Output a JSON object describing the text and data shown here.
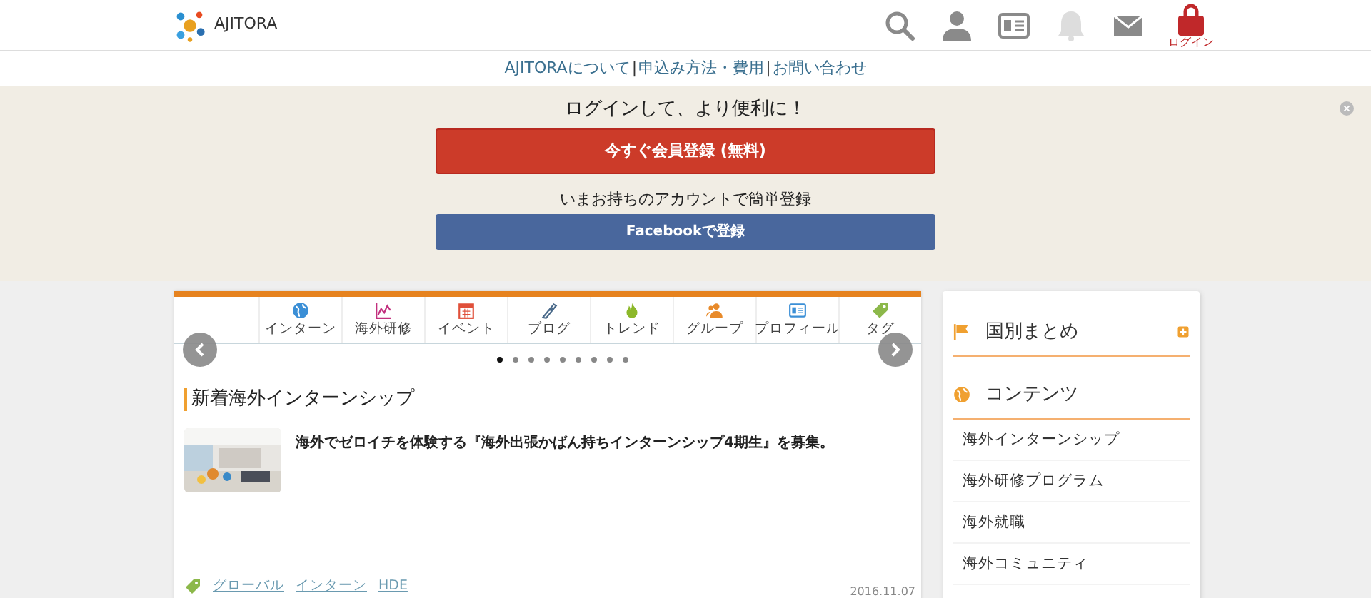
{
  "header": {
    "logo": "AJITORA",
    "icons": [
      {
        "kind": "search"
      },
      {
        "kind": "user"
      },
      {
        "kind": "card"
      },
      {
        "kind": "bell",
        "disabled": true
      },
      {
        "kind": "mail"
      },
      {
        "kind": "login",
        "label": "ログイン"
      }
    ]
  },
  "nav": [
    "AJITORAについて",
    "|",
    "申込み方法・費用",
    "|",
    "お問い合わせ"
  ],
  "banner": {
    "title": "ログインして、より便利に！",
    "register_button": "今すぐ会員登録 (無料)",
    "subtitle": "いまお持ちのアカウントで簡単登録",
    "facebook_button": "Facebookで登録"
  },
  "categories": [
    "インターン",
    "海外研修",
    "イベント",
    "ブログ",
    "トレンド",
    "グループ",
    "プロフィール",
    "タグ"
  ],
  "pager": [
    {
      "selected": true
    },
    {
      "selected": false
    },
    {
      "selected": false
    },
    {
      "selected": false
    },
    {
      "selected": false
    },
    {
      "selected": false
    },
    {
      "selected": false
    },
    {
      "selected": false
    },
    {
      "selected": false
    }
  ],
  "section_title": "新着海外インターンシップ",
  "article": {
    "kind": "picture",
    "title": "海外でゼロイチを体験する『海外出張かばん持ちインターンシップ4期生』を募集。",
    "tags": [
      "グローバル",
      "インターン",
      "HDE"
    ],
    "date": "2016.11.07"
  },
  "sidebar": {
    "country_heading": "国別まとめ",
    "contents_heading": "コンテンツ",
    "items": [
      "海外インターンシップ",
      "海外研修プログラム",
      "海外就職",
      "海外コミュニティ"
    ]
  }
}
